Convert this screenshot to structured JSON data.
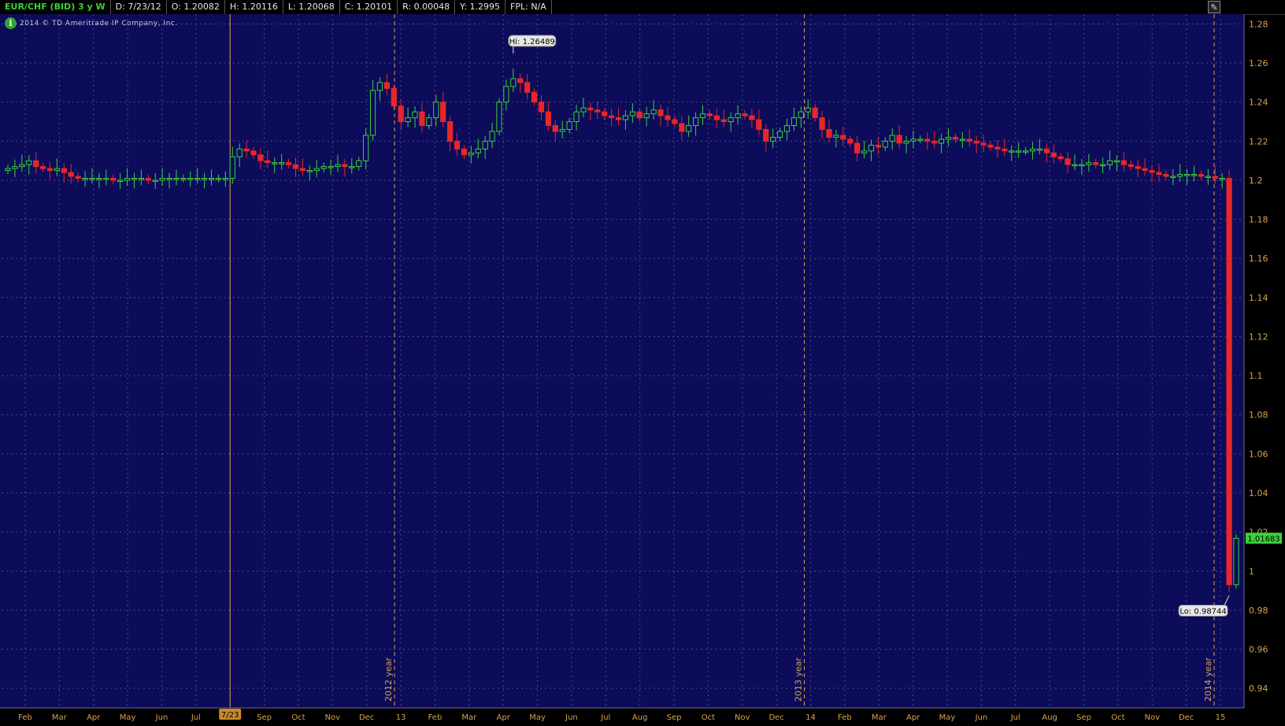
{
  "header": {
    "symbol": "EUR/CHF (BID) 3 y W",
    "date": "D: 7/23/12",
    "open": "O: 1.20082",
    "high": "H: 1.20116",
    "low": "L: 1.20068",
    "close": "C: 1.20101",
    "range": "R: 0.00048",
    "year": "Y: 1.2995",
    "fpl": "FPL: N/A"
  },
  "copyright": "2014 © TD Ameritrade IP Company, Inc.",
  "colors": {
    "background": "#0c0c5a",
    "up": "#39d23a",
    "down": "#e8262a",
    "grid": "#4b4b86",
    "axis": "#d8a24e"
  },
  "icons": {
    "info": "info-icon",
    "corner": "cursor-icon"
  },
  "chart_data": {
    "type": "candlestick",
    "y_axis_ticks": [
      "1.28",
      "1.26",
      "1.24",
      "1.22",
      "1.2",
      "1.18",
      "1.16",
      "1.14",
      "1.12",
      "1.1",
      "1.08",
      "1.06",
      "1.04",
      "1.02",
      "1",
      "0.98",
      "0.96",
      "0.94"
    ],
    "ylim": [
      0.93,
      1.285
    ],
    "x_labels": [
      "Feb",
      "Mar",
      "Apr",
      "May",
      "Jun",
      "Jul",
      "7/23",
      "Sep",
      "Oct",
      "Nov",
      "Dec",
      "13",
      "Feb",
      "Mar",
      "Apr",
      "May",
      "Jun",
      "Jul",
      "Aug",
      "Sep",
      "Oct",
      "Nov",
      "Dec",
      "14",
      "Feb",
      "Mar",
      "Apr",
      "May",
      "Jun",
      "Jul",
      "Aug",
      "Sep",
      "Oct",
      "Nov",
      "Dec",
      "15"
    ],
    "year_labels": [
      "2012 year",
      "2013 year",
      "2014 year"
    ],
    "hi_label": "Hi: 1.26489",
    "lo_label": "Lo: 0.98744",
    "last_price": "1.01683",
    "hi_value": 1.26489,
    "lo_value": 0.98744,
    "last_value": 1.01683,
    "series_close": [
      1.206,
      1.207,
      1.208,
      1.21,
      1.207,
      1.206,
      1.205,
      1.206,
      1.204,
      1.202,
      1.201,
      1.201,
      1.201,
      1.201,
      1.201,
      1.2,
      1.2,
      1.201,
      1.201,
      1.201,
      1.2,
      1.2,
      1.201,
      1.201,
      1.201,
      1.201,
      1.201,
      1.201,
      1.201,
      1.201,
      1.201,
      1.201,
      1.212,
      1.216,
      1.215,
      1.213,
      1.21,
      1.209,
      1.209,
      1.209,
      1.208,
      1.206,
      1.205,
      1.205,
      1.206,
      1.207,
      1.207,
      1.208,
      1.207,
      1.207,
      1.21,
      1.223,
      1.246,
      1.25,
      1.247,
      1.238,
      1.23,
      1.232,
      1.235,
      1.228,
      1.232,
      1.24,
      1.23,
      1.22,
      1.216,
      1.213,
      1.214,
      1.216,
      1.22,
      1.225,
      1.24,
      1.248,
      1.252,
      1.25,
      1.245,
      1.24,
      1.235,
      1.228,
      1.225,
      1.226,
      1.23,
      1.235,
      1.237,
      1.236,
      1.235,
      1.233,
      1.232,
      1.231,
      1.233,
      1.235,
      1.232,
      1.234,
      1.236,
      1.233,
      1.231,
      1.229,
      1.225,
      1.228,
      1.232,
      1.234,
      1.233,
      1.231,
      1.23,
      1.232,
      1.234,
      1.233,
      1.231,
      1.226,
      1.22,
      1.222,
      1.225,
      1.228,
      1.232,
      1.235,
      1.237,
      1.232,
      1.226,
      1.222,
      1.223,
      1.221,
      1.219,
      1.214,
      1.215,
      1.218,
      1.217,
      1.22,
      1.223,
      1.219,
      1.22,
      1.221,
      1.221,
      1.22,
      1.219,
      1.221,
      1.222,
      1.221,
      1.221,
      1.22,
      1.219,
      1.218,
      1.217,
      1.216,
      1.215,
      1.215,
      1.215,
      1.215,
      1.216,
      1.216,
      1.214,
      1.212,
      1.211,
      1.208,
      1.208,
      1.208,
      1.209,
      1.208,
      1.208,
      1.21,
      1.21,
      1.208,
      1.207,
      1.206,
      1.205,
      1.204,
      1.203,
      1.202,
      1.202,
      1.203,
      1.203,
      1.203,
      1.202,
      1.202,
      1.201,
      1.201,
      0.993,
      1.01683
    ]
  }
}
